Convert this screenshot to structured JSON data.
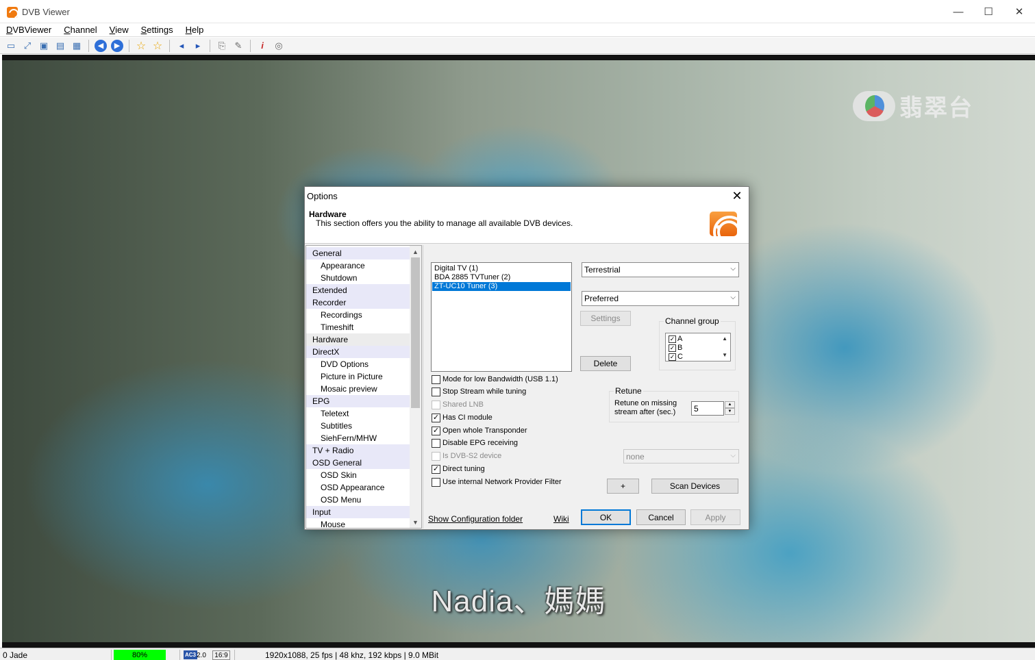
{
  "window": {
    "title": "DVB Viewer",
    "minimize": "—",
    "maximize": "☐",
    "close": "✕"
  },
  "menu": [
    "DVBViewer",
    "Channel",
    "View",
    "Settings",
    "Help"
  ],
  "video": {
    "channel_logo_text": "翡翠台",
    "subtitle": "Nadia、媽媽"
  },
  "statusbar": {
    "channel": "0 Jade",
    "signal": "80%",
    "audio_badge": "AC3",
    "audio_channels": "2.0",
    "aspect": "16:9",
    "stream_info": "1920x1088, 25 fps | 48 khz, 192 kbps | 9.0 MBit",
    "signal_color": "#00ff00"
  },
  "dialog": {
    "title": "Options",
    "close": "✕",
    "section_title": "Hardware",
    "section_desc": "This section offers you the ability to manage all available DVB devices.",
    "tree": [
      {
        "label": "General",
        "level": 0
      },
      {
        "label": "Appearance",
        "level": 1
      },
      {
        "label": "Shutdown",
        "level": 1
      },
      {
        "label": "Extended",
        "level": 0
      },
      {
        "label": "Recorder",
        "level": 0
      },
      {
        "label": "Recordings",
        "level": 1
      },
      {
        "label": "Timeshift",
        "level": 1
      },
      {
        "label": "Hardware",
        "level": 0
      },
      {
        "label": "DirectX",
        "level": 0
      },
      {
        "label": "DVD Options",
        "level": 1
      },
      {
        "label": "Picture in Picture",
        "level": 1
      },
      {
        "label": "Mosaic preview",
        "level": 1
      },
      {
        "label": "EPG",
        "level": 0
      },
      {
        "label": "Teletext",
        "level": 1
      },
      {
        "label": "Subtitles",
        "level": 1
      },
      {
        "label": "SiehFern/MHW",
        "level": 1
      },
      {
        "label": "TV + Radio",
        "level": 0
      },
      {
        "label": "OSD General",
        "level": 0
      },
      {
        "label": "OSD Skin",
        "level": 1
      },
      {
        "label": "OSD Appearance",
        "level": 1
      },
      {
        "label": "OSD Menu",
        "level": 1
      },
      {
        "label": "Input",
        "level": 0
      },
      {
        "label": "Mouse",
        "level": 1
      }
    ],
    "devices": [
      "Digital TV (1)",
      "BDA 2885 TVTuner (2)",
      "ZT-UC10 Tuner (3)"
    ],
    "selected_device": "ZT-UC10 Tuner (3)",
    "device_type": "Terrestrial",
    "priority": "Preferred",
    "settings_btn": "Settings",
    "delete_btn": "Delete",
    "channel_group": {
      "label": "Channel group",
      "items": [
        {
          "label": "A",
          "checked": true
        },
        {
          "label": "B",
          "checked": true
        },
        {
          "label": "C",
          "checked": true
        }
      ]
    },
    "options": [
      {
        "label": "Mode for low Bandwidth (USB 1.1)",
        "checked": false,
        "enabled": true
      },
      {
        "label": "Stop Stream while tuning",
        "checked": false,
        "enabled": true
      },
      {
        "label": "Shared LNB",
        "checked": false,
        "enabled": false
      },
      {
        "label": "Has CI module",
        "checked": true,
        "enabled": true
      },
      {
        "label": "Open whole Transponder",
        "checked": true,
        "enabled": true
      },
      {
        "label": "Disable EPG receiving",
        "checked": false,
        "enabled": true
      },
      {
        "label": "Is DVB-S2 device",
        "checked": false,
        "enabled": false
      },
      {
        "label": "Direct tuning",
        "checked": true,
        "enabled": true
      },
      {
        "label": "Use internal Network Provider Filter",
        "checked": false,
        "enabled": true
      }
    ],
    "retune": {
      "label": "Retune",
      "desc_line1": "Retune on missing",
      "desc_line2": "stream after (sec.)",
      "value": "5"
    },
    "dvbs2_combo": "none",
    "add_btn": "+",
    "scan_btn": "Scan Devices",
    "show_config_link": "Show Configuration folder",
    "wiki_link": "Wiki",
    "ok_btn": "OK",
    "cancel_btn": "Cancel",
    "apply_btn": "Apply"
  }
}
